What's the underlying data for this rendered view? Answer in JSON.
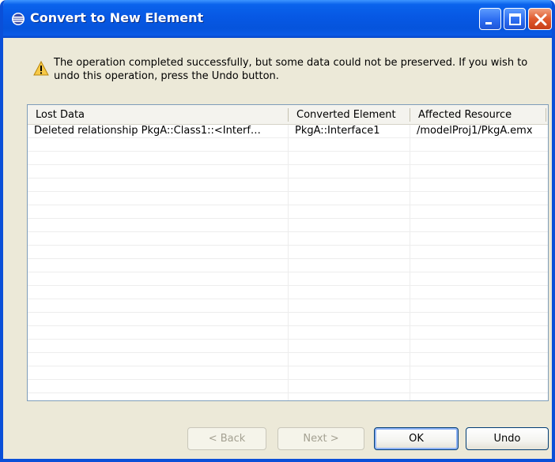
{
  "window": {
    "title": "Convert to New Element",
    "colors": {
      "titlebar": "#0758E4",
      "frame": "#0A4FD8",
      "dialog_bg": "#ECE9D8",
      "close_button": "#E05A2E"
    }
  },
  "message": {
    "icon": "warning-icon",
    "text": "The operation completed successfully, but some data could not be preserved. If you wish to undo this operation, press the Undo button."
  },
  "table": {
    "columns": [
      "Lost Data",
      "Converted Element",
      "Affected Resource"
    ],
    "rows": [
      [
        "Deleted relationship PkgA::Class1::<Interf…",
        "PkgA::Interface1",
        "/modelProj1/PkgA.emx"
      ]
    ]
  },
  "buttons": {
    "back": "< Back",
    "next": "Next >",
    "ok": "OK",
    "undo": "Undo"
  }
}
